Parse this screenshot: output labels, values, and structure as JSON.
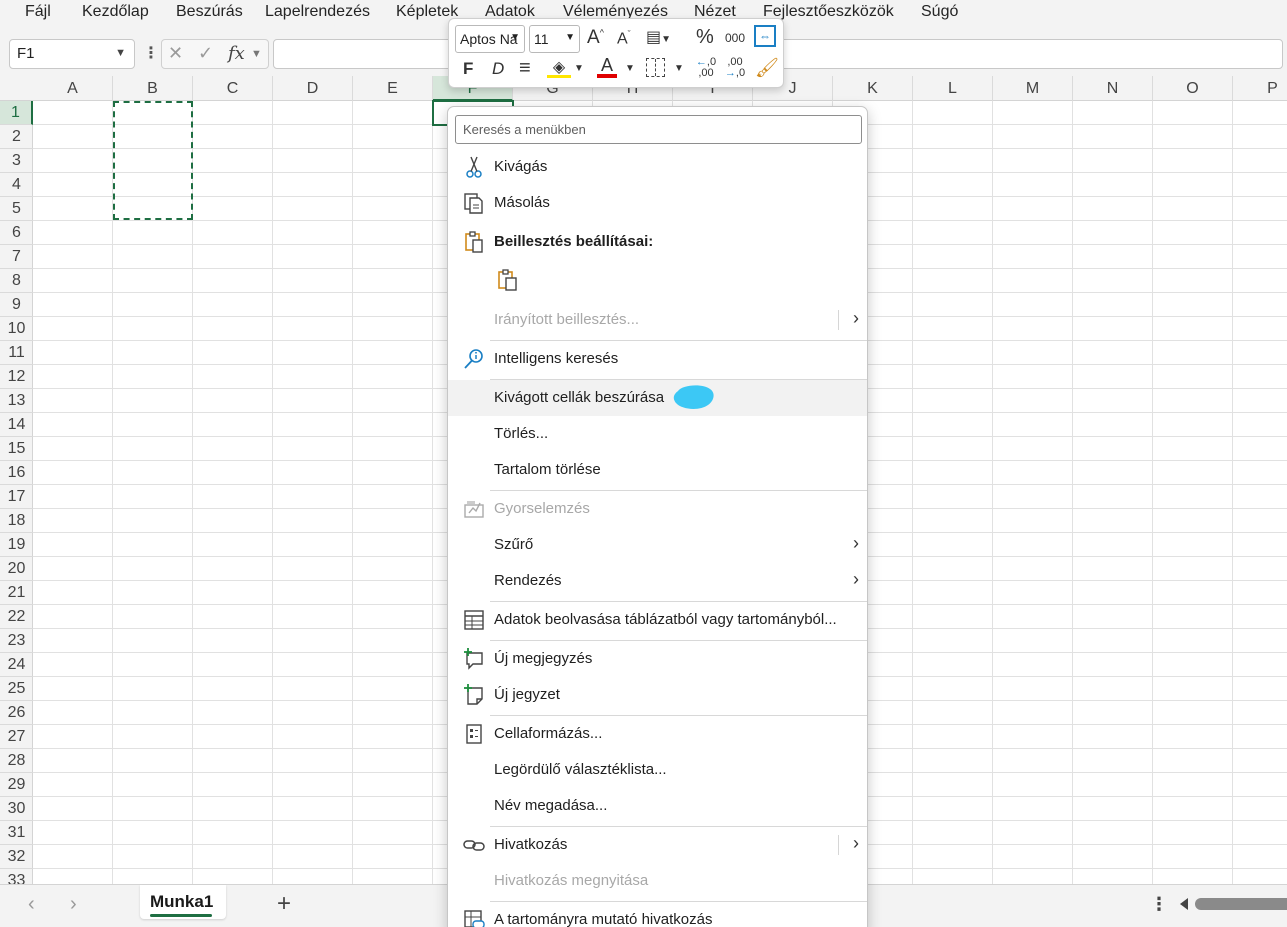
{
  "menubar": {
    "items": [
      "Fájl",
      "Kezdőlap",
      "Beszúrás",
      "Lapelrendezés",
      "Képletek",
      "Adatok",
      "Véleményezés",
      "Nézet",
      "Fejlesztőeszközök",
      "Súgó"
    ]
  },
  "formula_bar": {
    "name_box": "F1",
    "formula": ""
  },
  "columns": [
    "A",
    "B",
    "C",
    "D",
    "E",
    "F",
    "G",
    "H",
    "I",
    "J",
    "K",
    "L",
    "M",
    "N",
    "O",
    "P"
  ],
  "rows": [
    "1",
    "2",
    "3",
    "4",
    "5",
    "6",
    "7",
    "8",
    "9",
    "10",
    "11",
    "12",
    "13",
    "14",
    "15",
    "16",
    "17",
    "18",
    "19",
    "20",
    "21",
    "22",
    "23",
    "24",
    "25",
    "26",
    "27",
    "28",
    "29",
    "30",
    "31",
    "32",
    "33"
  ],
  "mini_toolbar": {
    "font_name": "Aptos Na",
    "font_size": "11",
    "bold_glyph": "F",
    "italic_glyph": "D",
    "percent_glyph": "%",
    "thousands_glyph": "000",
    "increase_decimal": ",0",
    "decrease_decimal": ",00",
    "accent_fill": "#ffe600",
    "accent_font": "#e00000"
  },
  "context_menu": {
    "search_placeholder": "Keresés a menükben",
    "items": [
      {
        "label": "Kivágás",
        "icon": "scissors-icon",
        "disabled": false
      },
      {
        "label": "Másolás",
        "icon": "copy-icon",
        "disabled": false
      },
      {
        "label": "Beillesztés beállításai:",
        "icon": "paste-icon",
        "disabled": false
      },
      {
        "label": "",
        "icon": "paste-option-icon",
        "disabled": false
      },
      {
        "label": "Irányított beillesztés...",
        "icon": "",
        "disabled": true
      },
      {
        "label": "Intelligens keresés",
        "icon": "smart-lookup-icon",
        "disabled": false
      },
      {
        "label": "Kivágott cellák beszúrása",
        "icon": "",
        "disabled": false
      },
      {
        "label": "Törlés...",
        "icon": "",
        "disabled": false
      },
      {
        "label": "Tartalom törlése",
        "icon": "",
        "disabled": false
      },
      {
        "label": "Gyorselemzés",
        "icon": "quick-analysis-icon",
        "disabled": true
      },
      {
        "label": "Szűrő",
        "icon": "",
        "disabled": false
      },
      {
        "label": "Rendezés",
        "icon": "",
        "disabled": false
      },
      {
        "label": "Adatok beolvasása táblázatból vagy tartományból...",
        "icon": "table-icon",
        "disabled": false
      },
      {
        "label": "Új megjegyzés",
        "icon": "new-comment-icon",
        "disabled": false
      },
      {
        "label": "Új jegyzet",
        "icon": "new-note-icon",
        "disabled": false
      },
      {
        "label": "Cellaformázás...",
        "icon": "format-cells-icon",
        "disabled": false
      },
      {
        "label": "Legördülő választéklista...",
        "icon": "",
        "disabled": false
      },
      {
        "label": "Név megadása...",
        "icon": "",
        "disabled": false
      },
      {
        "label": "Hivatkozás",
        "icon": "link-icon",
        "disabled": false
      },
      {
        "label": "Hivatkozás megnyitása",
        "icon": "",
        "disabled": true
      },
      {
        "label": "A tartományra mutató hivatkozás",
        "icon": "range-link-icon",
        "disabled": false
      }
    ]
  },
  "sheet_tabs": {
    "active": "Munka1"
  },
  "colors": {
    "excel_green": "#1e6e42",
    "highlight_blob": "#3cc8f5"
  }
}
